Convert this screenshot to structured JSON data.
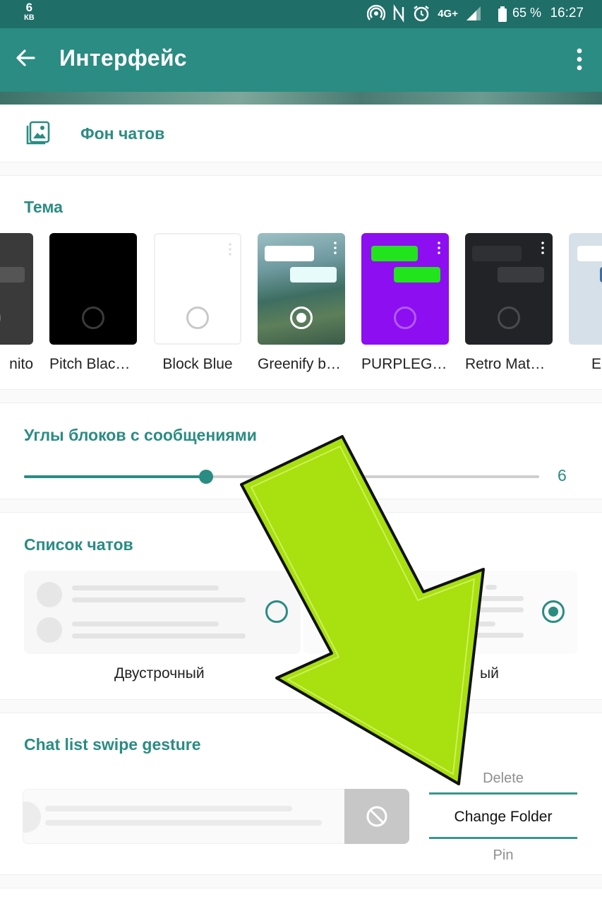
{
  "status_bar": {
    "kb_value": "6",
    "kb_unit": "КВ",
    "network": "4G+",
    "battery": "65 %",
    "time": "16:27"
  },
  "app_bar": {
    "title": "Интерфейс"
  },
  "chat_background": {
    "label": "Фон чатов"
  },
  "theme_section": {
    "title": "Тема",
    "themes": [
      {
        "name": "Incognito",
        "visible_name": "nito",
        "selected": false
      },
      {
        "name": "Pitch Black…",
        "selected": false
      },
      {
        "name": "Block Blue",
        "selected": false
      },
      {
        "name": "Greenify by…",
        "selected": true
      },
      {
        "name": "PURPLEGR…",
        "selected": false
      },
      {
        "name": "Retro Mate…",
        "selected": false
      },
      {
        "name": "En",
        "selected": false
      }
    ]
  },
  "corners_section": {
    "title": "Углы блоков с сообщениями",
    "value": "6",
    "min": 0,
    "max": 17
  },
  "chat_list_section": {
    "title": "Список чатов",
    "options": [
      {
        "label": "Двустрочный",
        "selected": false
      },
      {
        "label": "ый",
        "selected": true
      }
    ]
  },
  "swipe_section": {
    "title": "Chat list swipe gesture",
    "picker_above": "Delete",
    "picker_current": "Change Folder",
    "picker_below": "Pin"
  },
  "colors": {
    "accent": "#2a8c82",
    "status_bar": "#1f6e68",
    "arrow": "#a8e010"
  }
}
